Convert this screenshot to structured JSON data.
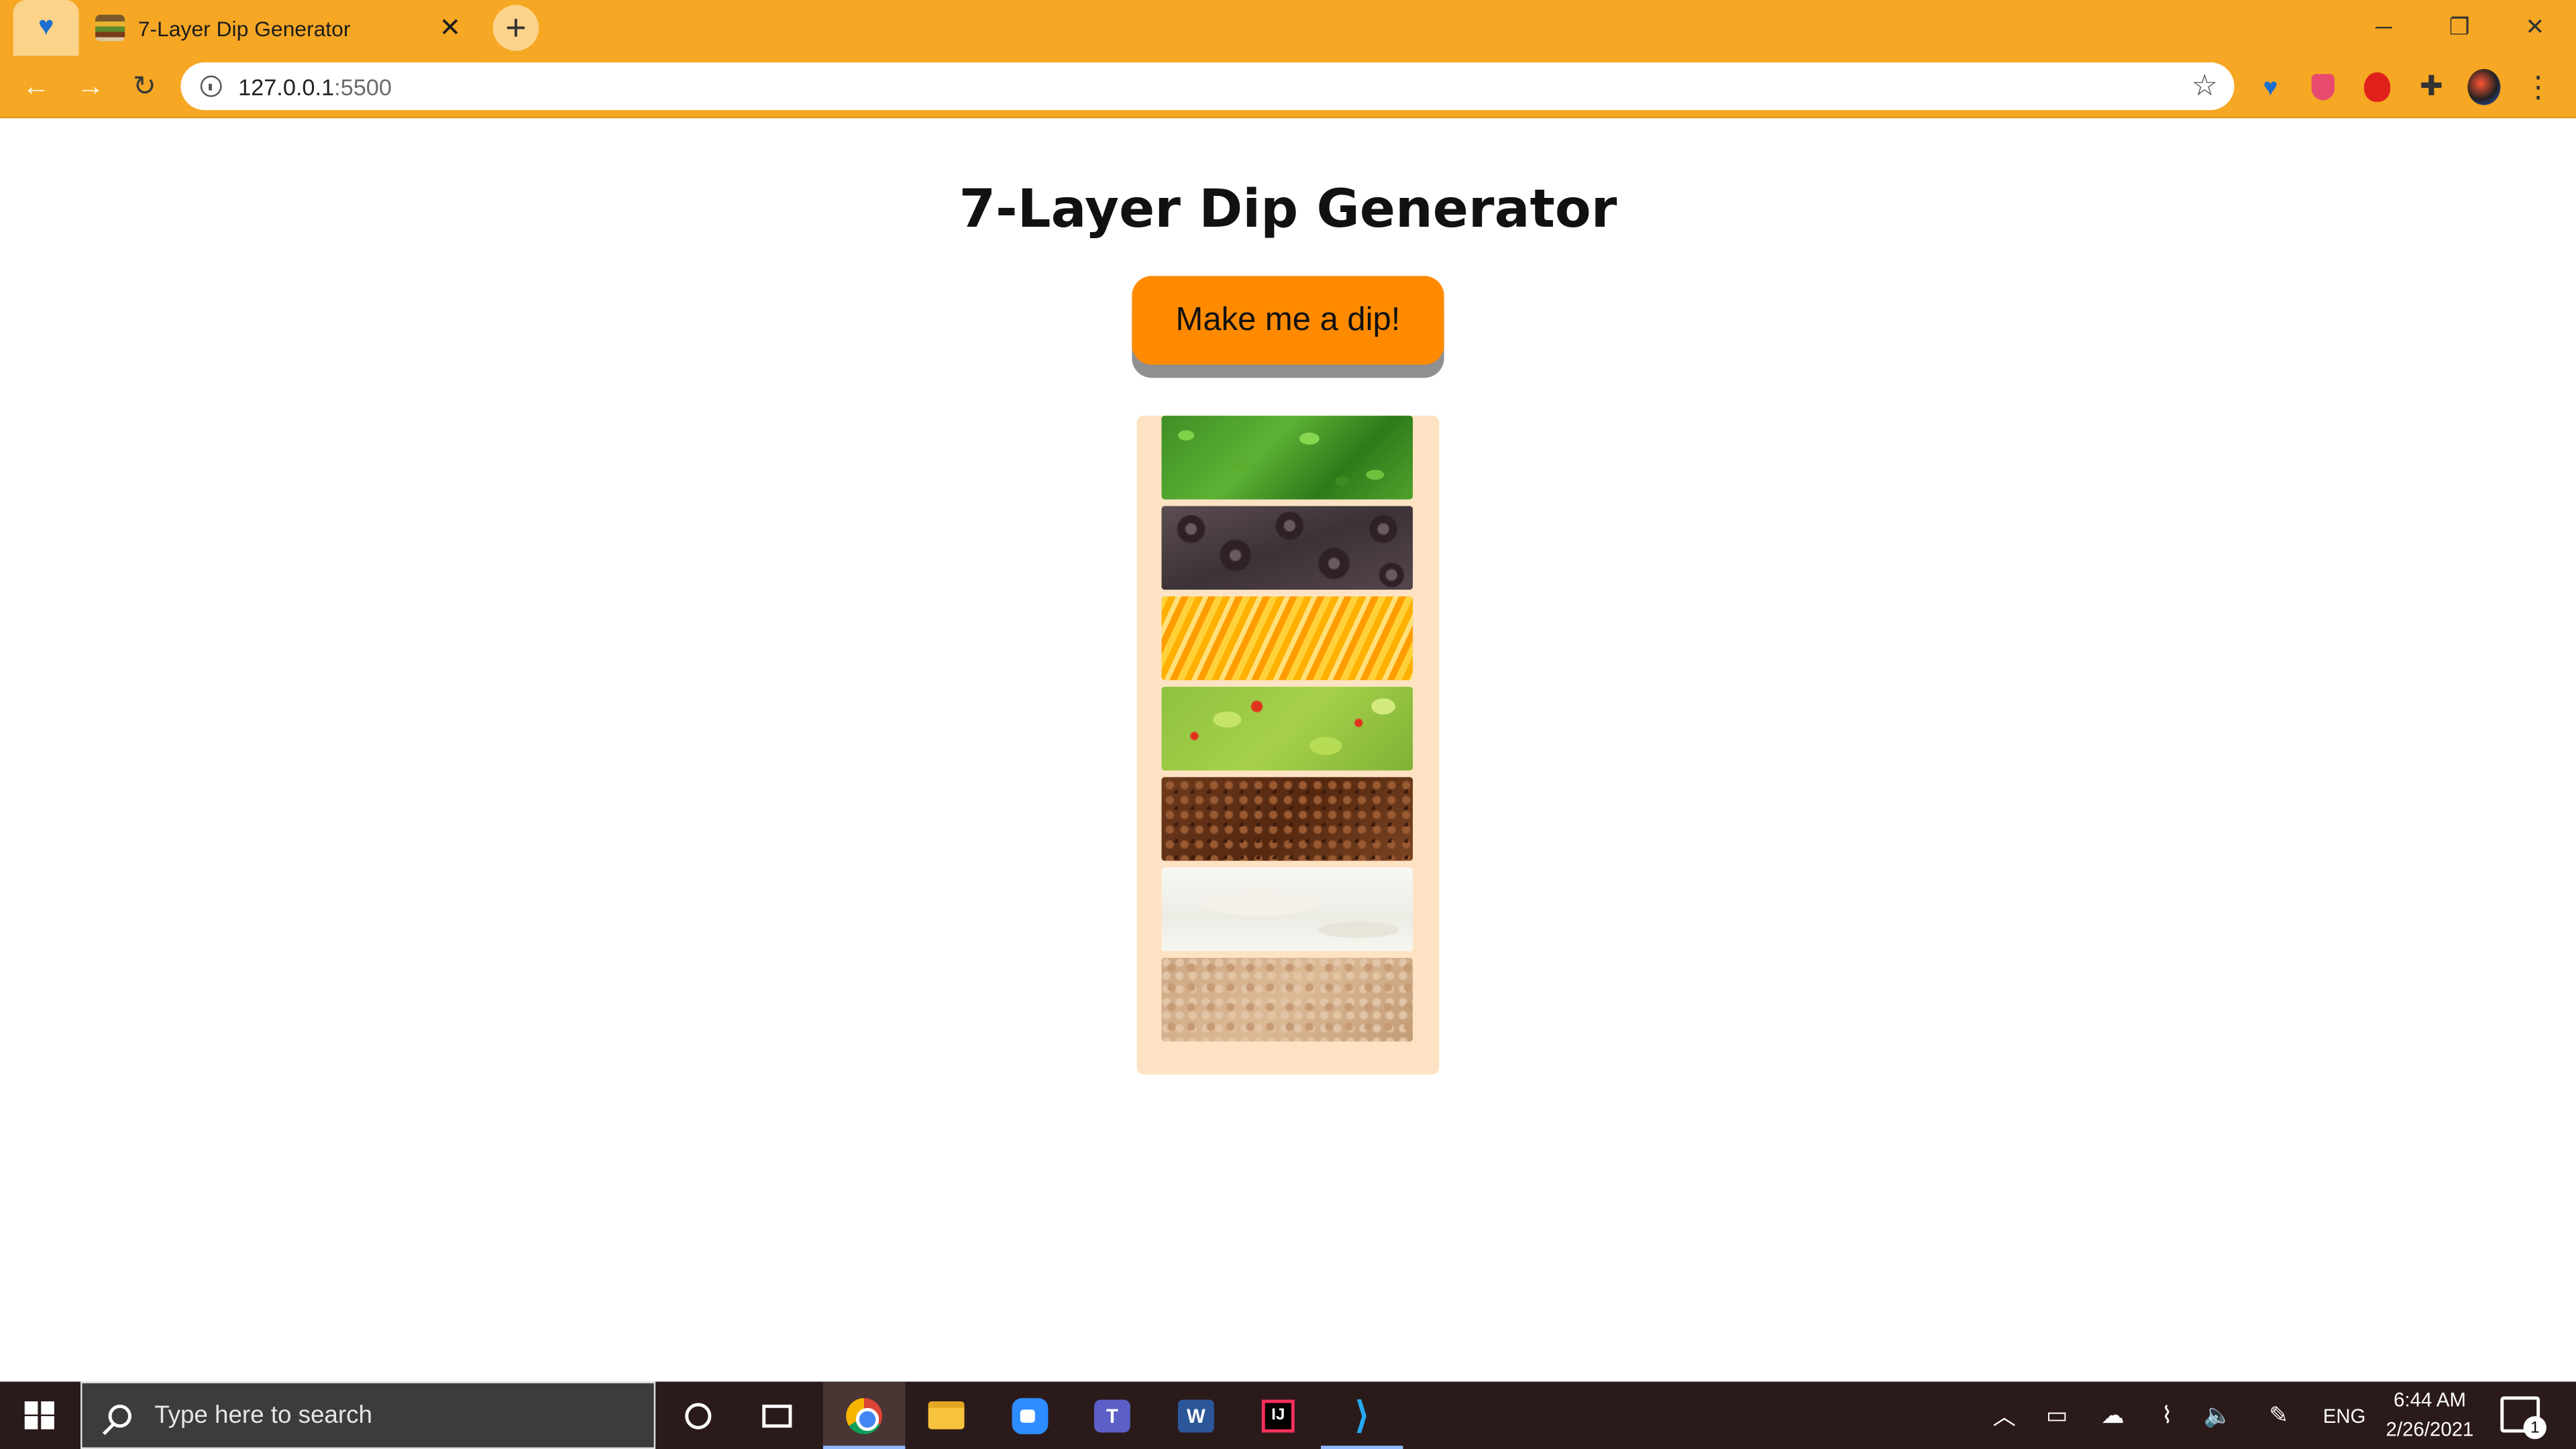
{
  "browser": {
    "tab_title": "7-Layer Dip Generator",
    "new_tab_symbol": "+",
    "url_host": "127.0.0.1",
    "url_port": ":5500",
    "window_controls": {
      "minimize": "─",
      "restore": "❐",
      "close": "✕"
    },
    "tab_close": "✕",
    "bookmark_icon": "star-icon",
    "theme_color": "#f6a723"
  },
  "page": {
    "title": "7-Layer Dip Generator",
    "button_label": "Make me a dip!",
    "button_color": "#ff8a00",
    "container_color": "#fde3c3",
    "layers": [
      {
        "name": "cilantro"
      },
      {
        "name": "black olives"
      },
      {
        "name": "shredded cheese"
      },
      {
        "name": "guacamole"
      },
      {
        "name": "ground beef"
      },
      {
        "name": "sour cream"
      },
      {
        "name": "refried beans"
      }
    ]
  },
  "taskbar": {
    "search_placeholder": "Type here to search",
    "language": "ENG",
    "time": "6:44 AM",
    "date": "2/26/2021",
    "notification_count": "1",
    "apps": [
      "cortana",
      "task-view",
      "chrome",
      "file-explorer",
      "zoom",
      "teams",
      "word",
      "intellij",
      "vscode"
    ]
  }
}
